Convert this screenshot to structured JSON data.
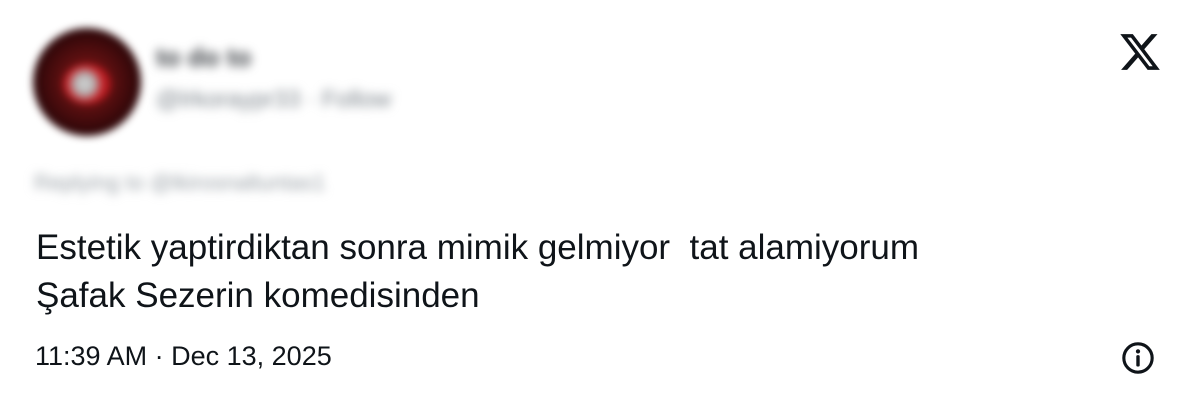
{
  "author": {
    "display_name": "to do to",
    "handle": "@lrkoraypr33",
    "separator": "·",
    "follow_label": "Follow",
    "avatar_icon": "avatar-image"
  },
  "reply_context": {
    "text": "Replying to @lkirosnaltuntas1"
  },
  "tweet": {
    "lines": [
      "Estetik yaptirdiktan sonra mimik gelmiyor  tat alamiyorum",
      "Şafak Sezerin komedisinden"
    ]
  },
  "meta": {
    "time": "11:39 AM",
    "separator": "·",
    "date": "Dec 13, 2025"
  },
  "icons": {
    "brand": "x-logo-icon",
    "info": "info-icon"
  }
}
